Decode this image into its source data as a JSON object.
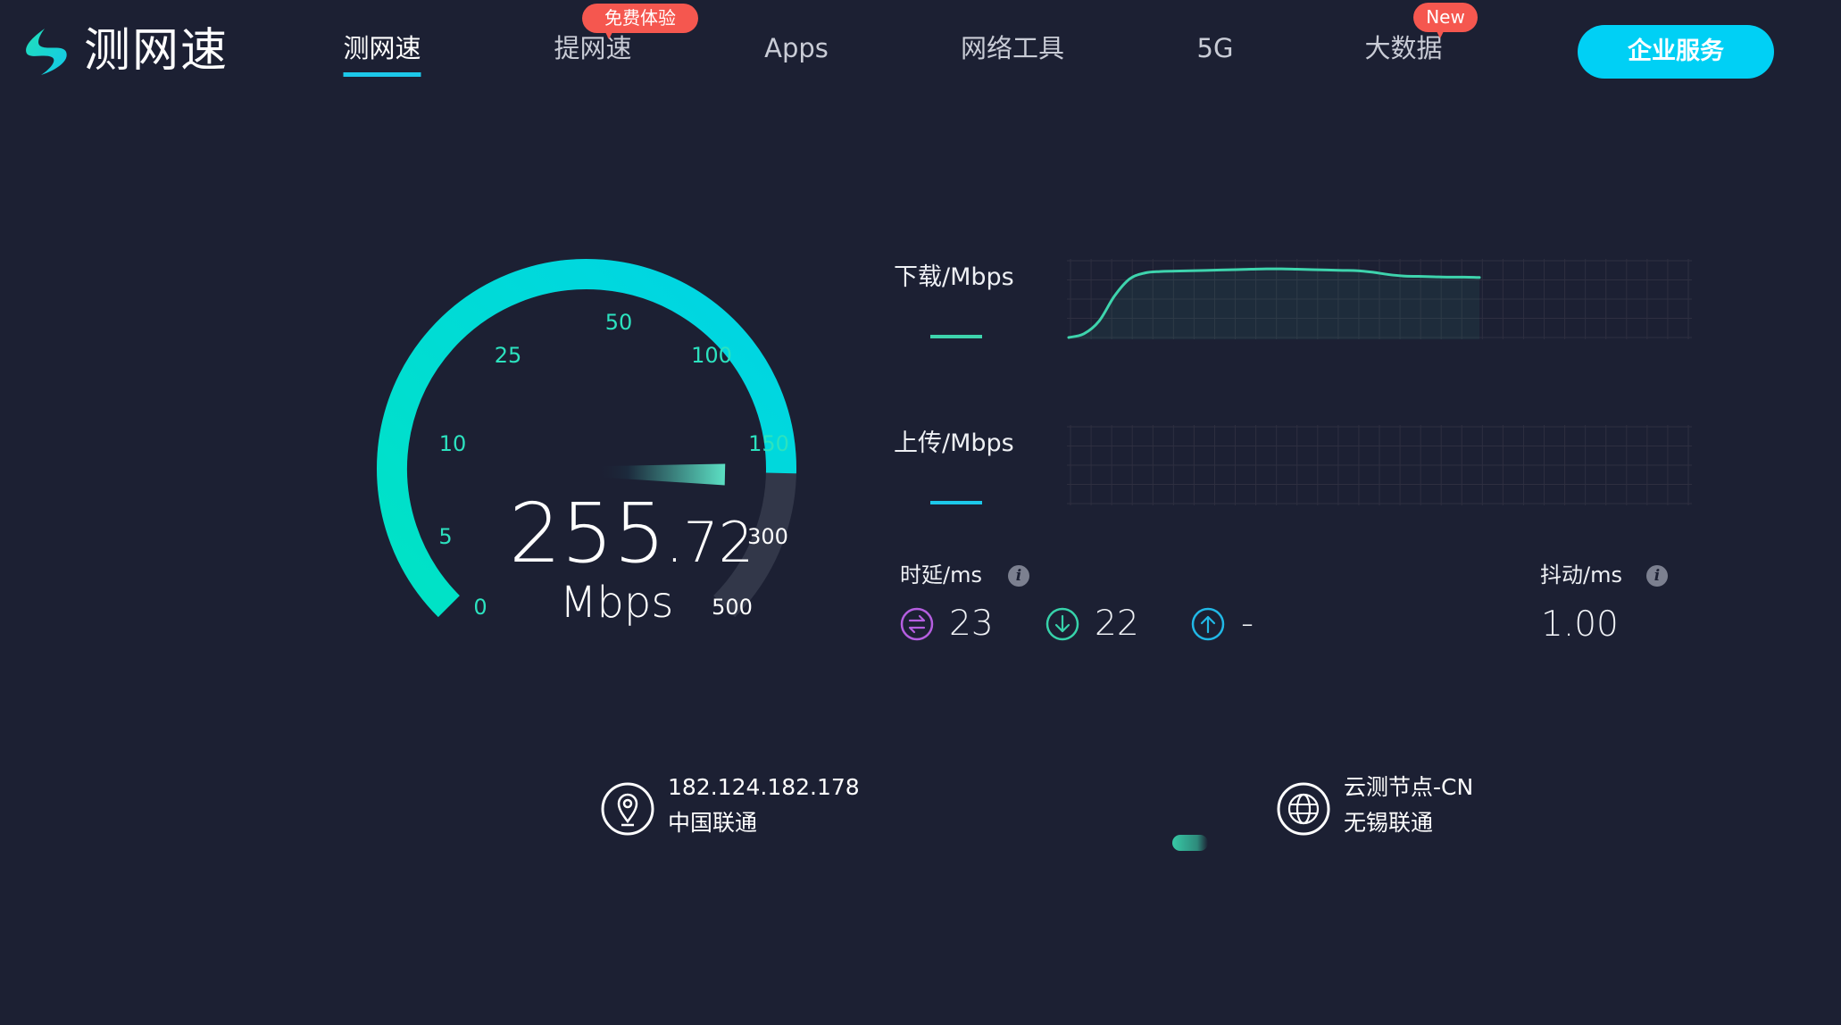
{
  "header": {
    "logo_text": "测网速",
    "nav": [
      {
        "label": "测网速",
        "active": true
      },
      {
        "label": "提网速",
        "badge": "免费体验"
      },
      {
        "label": "Apps"
      },
      {
        "label": "网络工具"
      },
      {
        "label": "5G"
      },
      {
        "label": "大数据",
        "badge": "New"
      }
    ],
    "cta_label": "企业服务"
  },
  "gauge": {
    "speed_integer": "255",
    "speed_decimal": ".72",
    "unit": "Mbps",
    "value": 255.72,
    "scale_ticks": [
      "0",
      "5",
      "10",
      "25",
      "50",
      "100",
      "150",
      "300",
      "500"
    ],
    "colors": {
      "arc_start": "#00e3c4",
      "arc_end": "#00d4e6",
      "track": "#323749"
    }
  },
  "chart_data": [
    {
      "type": "line",
      "title": "下载/Mbps",
      "series": [
        {
          "name": "download",
          "color": "#3ed4ad",
          "values": [
            0,
            5,
            22,
            55,
            78,
            86,
            88,
            88.5,
            89,
            89.5,
            90,
            90.5,
            91,
            91.5,
            91.5,
            91,
            90.5,
            90,
            89.5,
            89,
            87,
            84,
            82,
            81.5,
            81,
            80.5,
            80.5,
            80
          ]
        }
      ],
      "ylim": [
        0,
        100
      ],
      "grid": true,
      "legend_color": "#3ed4ad"
    },
    {
      "type": "line",
      "title": "上传/Mbps",
      "series": [
        {
          "name": "upload",
          "color": "#1cc8ea",
          "values": []
        }
      ],
      "ylim": [
        0,
        100
      ],
      "grid": true,
      "legend_color": "#1cc8ea"
    }
  ],
  "latency": {
    "label": "时延/ms",
    "info_icon": "i",
    "items": [
      {
        "icon": "exchange-icon",
        "value": "23",
        "color": "#b55ee0"
      },
      {
        "icon": "download-arrow-icon",
        "value": "22",
        "color": "#37d2aa"
      },
      {
        "icon": "upload-arrow-icon",
        "value": "-",
        "color": "#21b8e6"
      }
    ]
  },
  "jitter": {
    "label": "抖动/ms",
    "info_icon": "i",
    "value": "1.00"
  },
  "client": {
    "ip": "182.124.182.178",
    "isp": "中国联通"
  },
  "server": {
    "name": "云测节点-CN",
    "location": "无锡联通"
  }
}
